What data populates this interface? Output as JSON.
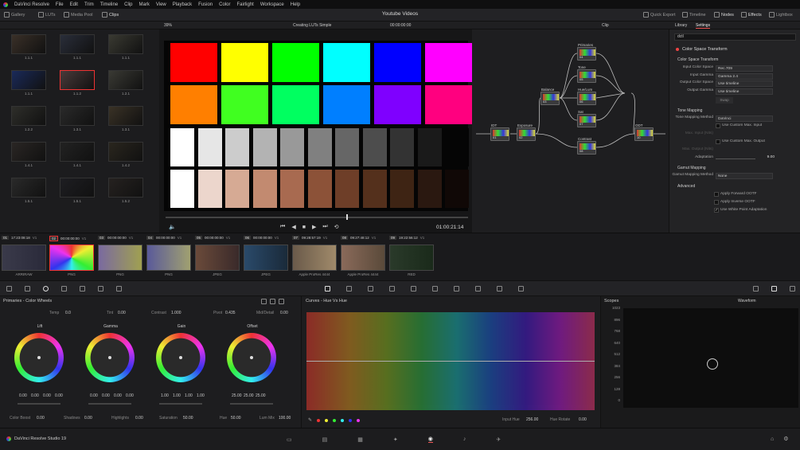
{
  "app_title": "DaVinci Resolve",
  "menu": [
    "File",
    "Edit",
    "Trim",
    "Timeline",
    "Clip",
    "Mark",
    "View",
    "Playback",
    "Fusion",
    "Color",
    "Fairlight",
    "Workspace",
    "Help"
  ],
  "toolbar": {
    "gallery": "Gallery",
    "luts": "LUTs",
    "media_pool": "Media Pool",
    "clips": "Clips",
    "project_title": "Youtube Videos",
    "quick_export": "Quick Export",
    "timeline": "Timeline",
    "nodes": "Nodes",
    "effects": "Effects",
    "lightbox": "Lightbox"
  },
  "subbar": {
    "zoom": "39%",
    "timeline_name": "Creating LUTs Simple",
    "timecode": "00:00:00:00",
    "clip_label": "Clip",
    "library_tab": "Library",
    "settings_tab": "Settings"
  },
  "media_thumbs": [
    {
      "label": "1.1.1"
    },
    {
      "label": "1.1.1"
    },
    {
      "label": "1.1.1"
    },
    {
      "label": "1.1.1"
    },
    {
      "label": "1.1.2"
    },
    {
      "label": "1.2.1"
    },
    {
      "label": "1.2.2"
    },
    {
      "label": "1.3.1"
    },
    {
      "label": "1.3.1"
    },
    {
      "label": "1.4.1"
    },
    {
      "label": "1.4.1"
    },
    {
      "label": "1.4.2"
    },
    {
      "label": "1.5.1"
    },
    {
      "label": "1.5.1"
    },
    {
      "label": "1.5.2"
    }
  ],
  "viewer": {
    "timecode": "01:00:21:14"
  },
  "swatches": {
    "row1": [
      "#ff0000",
      "#ffff00",
      "#00ff00",
      "#00ffff",
      "#0000ff",
      "#ff00ff"
    ],
    "row2": [
      "#ff7f00",
      "#40ff20",
      "#00ff60",
      "#007fff",
      "#7f00ff",
      "#ff007f"
    ],
    "row3": [
      "#ffffff",
      "#e6e6e6",
      "#cccccc",
      "#b3b3b3",
      "#999999",
      "#808080",
      "#666666",
      "#4d4d4d",
      "#333333",
      "#1a1a1a",
      "#050505"
    ],
    "row4": [
      "#ffffff",
      "#ecd6cc",
      "#d6aa94",
      "#c28a70",
      "#a86a50",
      "#8c5238",
      "#6e3e28",
      "#54301c",
      "#3e2414",
      "#2a1810",
      "#100806"
    ]
  },
  "nodes": [
    {
      "title": "Primaries",
      "num": "04"
    },
    {
      "title": "Tone",
      "num": "05"
    },
    {
      "title": "Hue/Lum",
      "num": "06"
    },
    {
      "title": "Sat",
      "num": "07"
    },
    {
      "title": "Balance",
      "num": "03"
    },
    {
      "title": "IDT",
      "num": "01"
    },
    {
      "title": "Exposure",
      "num": "02"
    },
    {
      "title": "Contrast",
      "num": "08"
    },
    {
      "title": "ODT",
      "num": "10"
    }
  ],
  "settings": {
    "search": "dctl",
    "effect_name": "Color Space Transform",
    "section_cst": "Color Space Transform",
    "rows": [
      {
        "label": "Input Color Space",
        "value": "Rec.709"
      },
      {
        "label": "Input Gamma",
        "value": "Gamma 2.4"
      },
      {
        "label": "Output Color Space",
        "value": "Use timeline"
      },
      {
        "label": "Output Gamma",
        "value": "Use timeline"
      }
    ],
    "swap": "Swap",
    "section_tone": "Tone Mapping",
    "tone_method_label": "Tone Mapping Method",
    "tone_method_value": "DaVinci",
    "custom_input": "Use Custom Max. Input",
    "max_input_label": "Max. Input (Nits)",
    "custom_output": "Use Custom Max. Output",
    "max_output_label": "Max. Output (Nits)",
    "adaptation_label": "Adaptation",
    "adaptation_value": "9.00",
    "section_gamut": "Gamut Mapping",
    "gamut_method_label": "Gamut Mapping Method",
    "gamut_method_value": "None",
    "section_adv": "Advanced",
    "apply_fwd": "Apply Forward OOTF",
    "apply_inv": "Apply Inverse OOTF",
    "white_point": "Use White Point Adaptation"
  },
  "clips": [
    {
      "n": "01",
      "tc": "17:23:08:18",
      "track": "V1",
      "type": "ARRIRAW"
    },
    {
      "n": "02",
      "tc": "00:00:00:00",
      "track": "V1",
      "type": "PNG"
    },
    {
      "n": "03",
      "tc": "00:00:00:00",
      "track": "V1",
      "type": "PNG"
    },
    {
      "n": "04",
      "tc": "00:00:00:00",
      "track": "V1",
      "type": "PNG"
    },
    {
      "n": "05",
      "tc": "00:00:00:00",
      "track": "V1",
      "type": "JPEG"
    },
    {
      "n": "06",
      "tc": "00:00:00:00",
      "track": "V1",
      "type": "JPEG"
    },
    {
      "n": "07",
      "tc": "09:28:57:19",
      "track": "V1",
      "type": "Apple ProRes 4444"
    },
    {
      "n": "08",
      "tc": "09:27:48:12",
      "track": "V1",
      "type": "Apple ProRes 4444"
    },
    {
      "n": "09",
      "tc": "19:22:56:12",
      "track": "V1",
      "type": "RED"
    }
  ],
  "wheels": {
    "panel_title": "Primaries - Color Wheels",
    "temp_label": "Temp",
    "temp": "0.0",
    "tint_label": "Tint",
    "tint": "0.00",
    "contrast_label": "Contrast",
    "contrast": "1.000",
    "pivot_label": "Pivot",
    "pivot": "0.435",
    "middetail_label": "Mid/Detail",
    "middetail": "0.00",
    "lift": {
      "name": "Lift",
      "vals": [
        "0.00",
        "0.00",
        "0.00",
        "0.00"
      ]
    },
    "gamma": {
      "name": "Gamma",
      "vals": [
        "0.00",
        "0.00",
        "0.00",
        "0.00"
      ]
    },
    "gain": {
      "name": "Gain",
      "vals": [
        "1.00",
        "1.00",
        "1.00",
        "1.00"
      ]
    },
    "offset": {
      "name": "Offset",
      "vals": [
        "25.00",
        "25.00",
        "25.00"
      ]
    },
    "color_boost_label": "Color Boost",
    "color_boost": "0.00",
    "shadows_label": "Shadows",
    "shadows": "0.00",
    "highlights_label": "Highlights",
    "highlights": "0.00",
    "saturation_label": "Saturation",
    "saturation": "50.00",
    "hue_label": "Hue",
    "hue": "50.00",
    "lummix_label": "Lum Mix",
    "lummix": "100.00"
  },
  "curves": {
    "title": "Curves - Hue Vs Hue",
    "input_hue_label": "Input Hue",
    "input_hue": "256.00",
    "hue_rotate_label": "Hue Rotate",
    "hue_rotate": "0.00"
  },
  "scopes": {
    "title": "Scopes",
    "mode": "Waveform",
    "ticks": [
      "1023",
      "896",
      "768",
      "640",
      "512",
      "384",
      "256",
      "128",
      "0"
    ]
  },
  "footer": {
    "product": "DaVinci Resolve Studio 19"
  }
}
